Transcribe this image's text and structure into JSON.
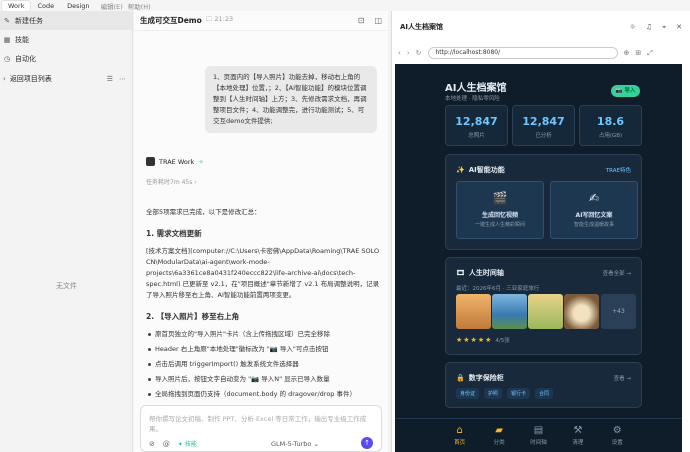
{
  "topbar": {
    "tabs": [
      "Work",
      "Code",
      "Design"
    ],
    "menus": [
      "编辑(E)",
      "帮助(H)"
    ]
  },
  "sidebar": {
    "items": [
      {
        "label": "新建任务",
        "icon": "new-task-icon"
      },
      {
        "label": "技能",
        "icon": "skill-icon"
      },
      {
        "label": "自动化",
        "icon": "automation-icon"
      }
    ],
    "project_label": "返回项目列表",
    "empty_label": "无文件"
  },
  "chat": {
    "title": "生成可交互Demo",
    "time": "21:23",
    "user_message": "1、页面内的【导入照片】功能去掉，移动右上角的【本地处理】位置，；2、【AI智能功能】的模块位置调整到【人生时间轴】上方；3、先修改需求文档，再调整项目文件；4、功能调整完，进行功能测试；5、可交互demo文件提供;",
    "agent_name": "TRAE Work",
    "elapsed": "任务耗时7m 45s",
    "intro": "全部5项需求已完成，以下是修改汇总：",
    "section1_title": "1. 需求文档更新",
    "section1_text": "[技术方案文档](computer://C:\\Users\\卡密佛\\AppData\\Roaming\\TRAE SOLO CN\\ModularData\\ai-agent\\work-mode-projects\\6a3361ce8a0431f240eccc822\\life-archive-ai\\docs\\tech-spec.html) 已更新至 v2.1，在\"项目概述\"章节新增了 v2.1 布局调整说明，记录了导入照片移至右上角、AI智能功能前置两项变更。",
    "section1_bold": "v2.1 布局调整说明",
    "section2_title": "2. 【导入照片】移至右上角",
    "bullets": [
      "原首页独立的\"导入照片\"卡片（含上传拖拽区域）已完全移除",
      "Header 右上角原\"本地处理\"徽标改为 \"📷 导入\"可点击按钮",
      "点击后调用 triggerImport() 触发系统文件选择器",
      "导入照片后，按钮文字自动变为 \"📷 导入N\" 显示已导入数量",
      "全局拖拽到页面仍支持（document.body 的 dragover/drop 事件）"
    ],
    "input_placeholder": "帮你撰写论文初稿、制作 PPT、分析 Excel 等日常工作，输出专业级工作成果。",
    "model": "GLM-5-Turbo",
    "skill_label": "技能"
  },
  "browser": {
    "title": "AI人生档案馆",
    "url": "http://localhost:8080/",
    "app": {
      "title": "AI人生档案馆",
      "subtitle": "本地处理 · 隐私零风险",
      "import_button": "📷 导入",
      "stats": [
        {
          "value": "12,847",
          "label": "总照片"
        },
        {
          "value": "12,847",
          "label": "已分析"
        },
        {
          "value": "18.6",
          "label": "占用(GB)"
        }
      ],
      "ai_card": {
        "title": "AI智能功能",
        "link": "TRAE特色",
        "features": [
          {
            "name": "生成回忆视频",
            "desc": "一键生成人生精彩瞬间"
          },
          {
            "name": "AI写回忆文案",
            "desc": "智能生成温暖故事"
          }
        ]
      },
      "timeline_card": {
        "title": "人生时间轴",
        "link": "查看全部 →",
        "subtitle": "最近：2026年6月 · 三亚家庭旅行",
        "more": "+43",
        "stars": "★★★★★",
        "count": "4/5张"
      },
      "vault_card": {
        "title": "数字保险柜",
        "link": "查看 →",
        "tags": [
          "身份证",
          "护照",
          "银行卡",
          "合同"
        ]
      },
      "tabs": [
        {
          "label": "首页",
          "icon": "home-icon"
        },
        {
          "label": "分类",
          "icon": "folder-icon"
        },
        {
          "label": "时间轴",
          "icon": "film-icon"
        },
        {
          "label": "清理",
          "icon": "broom-icon"
        },
        {
          "label": "设置",
          "icon": "gear-icon"
        }
      ]
    }
  },
  "colors": {
    "accent": "#5a4bf0",
    "app_bg": "#0f1d2b",
    "stat_value": "#6ec6ff",
    "import_green": "#36d19a",
    "star": "#f5b82e"
  }
}
